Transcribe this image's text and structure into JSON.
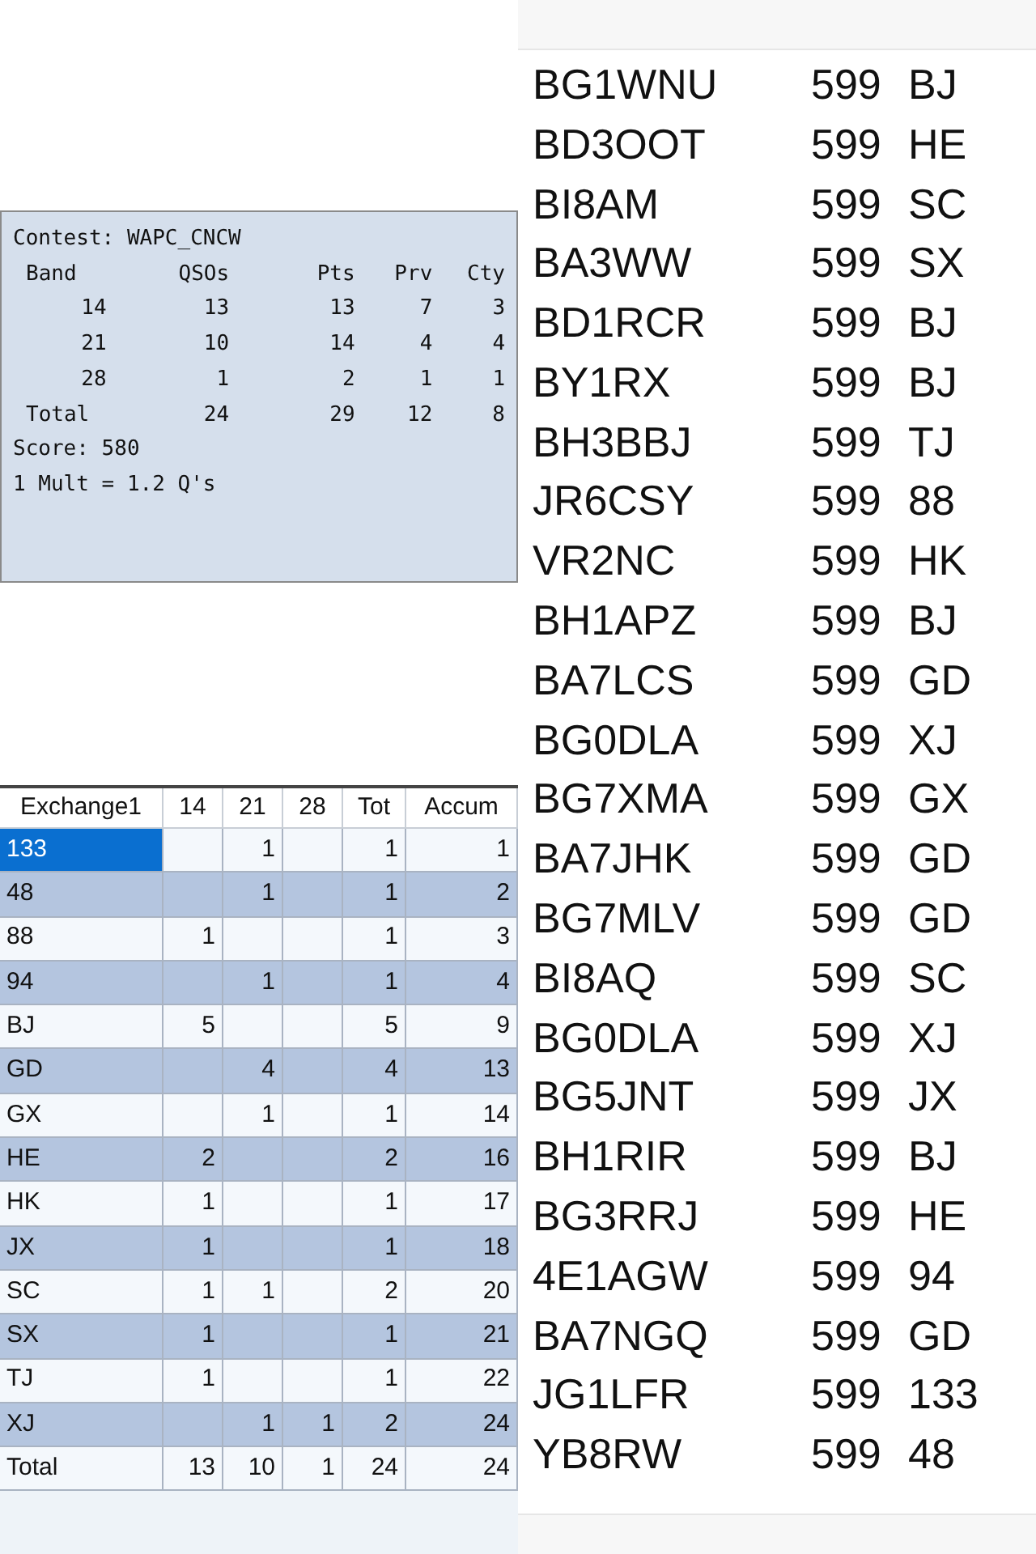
{
  "summary": {
    "title": "Contest: WAPC_CNCW",
    "columns": [
      "Band",
      "QSOs",
      "Pts",
      "Prv",
      "Cty"
    ],
    "rows": [
      [
        "14",
        "13",
        "13",
        "7",
        "3"
      ],
      [
        "21",
        "10",
        "14",
        "4",
        "4"
      ],
      [
        "28",
        "1",
        "2",
        "1",
        "1"
      ],
      [
        "Total",
        "24",
        "29",
        "12",
        "8"
      ]
    ],
    "score": "Score: 580",
    "mult": "1 Mult = 1.2 Q's"
  },
  "exchange_table": {
    "columns": [
      "Exchange1",
      "14",
      "21",
      "28",
      "Tot",
      "Accum"
    ],
    "rows": [
      {
        "cells": [
          "133",
          "",
          "1",
          "",
          "1",
          "1"
        ],
        "selected": true
      },
      {
        "cells": [
          "48",
          "",
          "1",
          "",
          "1",
          "2"
        ],
        "selected": false
      },
      {
        "cells": [
          "88",
          "1",
          "",
          "",
          "1",
          "3"
        ],
        "selected": false
      },
      {
        "cells": [
          "94",
          "",
          "1",
          "",
          "1",
          "4"
        ],
        "selected": false
      },
      {
        "cells": [
          "BJ",
          "5",
          "",
          "",
          "5",
          "9"
        ],
        "selected": false
      },
      {
        "cells": [
          "GD",
          "",
          "4",
          "",
          "4",
          "13"
        ],
        "selected": false
      },
      {
        "cells": [
          "GX",
          "",
          "1",
          "",
          "1",
          "14"
        ],
        "selected": false
      },
      {
        "cells": [
          "HE",
          "2",
          "",
          "",
          "2",
          "16"
        ],
        "selected": false
      },
      {
        "cells": [
          "HK",
          "1",
          "",
          "",
          "1",
          "17"
        ],
        "selected": false
      },
      {
        "cells": [
          "JX",
          "1",
          "",
          "",
          "1",
          "18"
        ],
        "selected": false
      },
      {
        "cells": [
          "SC",
          "1",
          "1",
          "",
          "2",
          "20"
        ],
        "selected": false
      },
      {
        "cells": [
          "SX",
          "1",
          "",
          "",
          "1",
          "21"
        ],
        "selected": false
      },
      {
        "cells": [
          "TJ",
          "1",
          "",
          "",
          "1",
          "22"
        ],
        "selected": false
      },
      {
        "cells": [
          "XJ",
          "",
          "1",
          "1",
          "2",
          "24"
        ],
        "selected": false
      },
      {
        "cells": [
          "Total",
          "13",
          "10",
          "1",
          "24",
          "24"
        ],
        "selected": false
      }
    ]
  },
  "log": [
    {
      "call": "BG1WNU",
      "rst": "599",
      "exchange": "BJ"
    },
    {
      "call": "BD3OOT",
      "rst": "599",
      "exchange": "HE"
    },
    {
      "call": "BI8AM",
      "rst": "599",
      "exchange": "SC"
    },
    {
      "call": "BA3WW",
      "rst": "599",
      "exchange": "SX"
    },
    {
      "call": "BD1RCR",
      "rst": "599",
      "exchange": "BJ"
    },
    {
      "call": "BY1RX",
      "rst": "599",
      "exchange": "BJ"
    },
    {
      "call": "BH3BBJ",
      "rst": "599",
      "exchange": "TJ"
    },
    {
      "call": "JR6CSY",
      "rst": "599",
      "exchange": "88"
    },
    {
      "call": "VR2NC",
      "rst": "599",
      "exchange": "HK"
    },
    {
      "call": "BH1APZ",
      "rst": "599",
      "exchange": "BJ"
    },
    {
      "call": "BA7LCS",
      "rst": "599",
      "exchange": "GD"
    },
    {
      "call": "BG0DLA",
      "rst": "599",
      "exchange": "XJ"
    },
    {
      "call": "BG7XMA",
      "rst": "599",
      "exchange": "GX"
    },
    {
      "call": "BA7JHK",
      "rst": "599",
      "exchange": "GD"
    },
    {
      "call": "BG7MLV",
      "rst": "599",
      "exchange": "GD"
    },
    {
      "call": "BI8AQ",
      "rst": "599",
      "exchange": "SC"
    },
    {
      "call": "BG0DLA",
      "rst": "599",
      "exchange": "XJ"
    },
    {
      "call": "BG5JNT",
      "rst": "599",
      "exchange": "JX"
    },
    {
      "call": "BH1RIR",
      "rst": "599",
      "exchange": "BJ"
    },
    {
      "call": "BG3RRJ",
      "rst": "599",
      "exchange": "HE"
    },
    {
      "call": "4E1AGW",
      "rst": "599",
      "exchange": "94"
    },
    {
      "call": "BA7NGQ",
      "rst": "599",
      "exchange": "GD"
    },
    {
      "call": "JG1LFR",
      "rst": "599",
      "exchange": "133"
    },
    {
      "call": "YB8RW",
      "rst": "599",
      "exchange": "48"
    }
  ]
}
